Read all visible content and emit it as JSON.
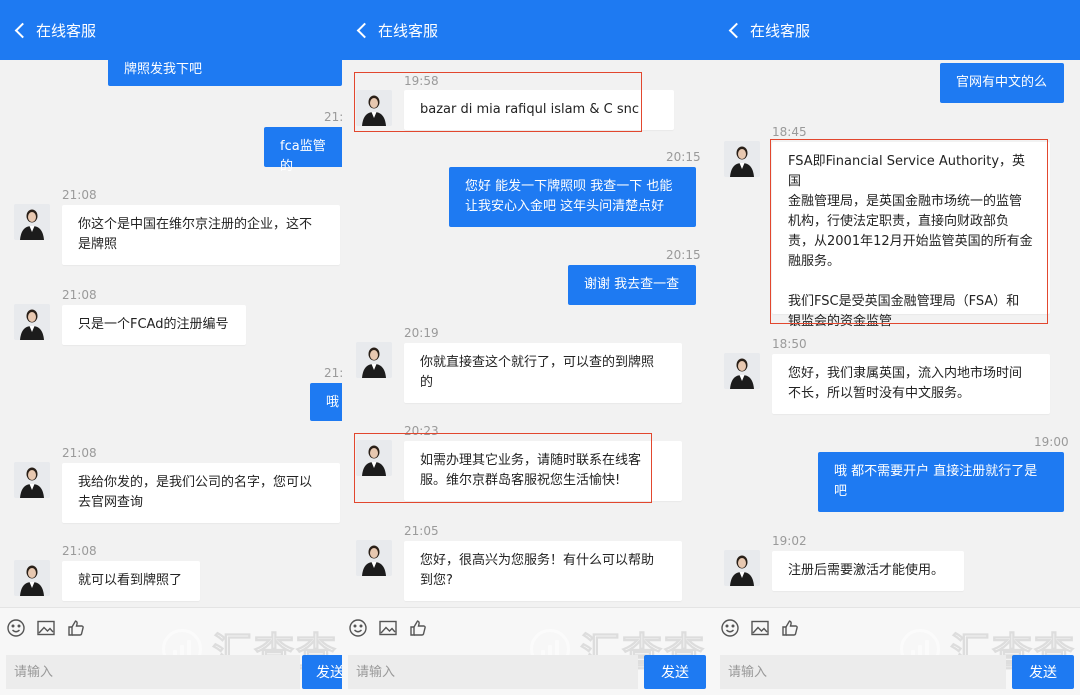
{
  "common": {
    "header_title": "在线客服",
    "input_placeholder": "请输入",
    "send_label": "发送",
    "watermark": "汇查查"
  },
  "panel1": {
    "messages": [
      {
        "dir": "out",
        "text": "牌照发我下吧"
      },
      {
        "dir": "out",
        "time": "21:",
        "text": "fca监管的"
      },
      {
        "dir": "in",
        "time": "21:08",
        "text": "你这个是中国在维尔京注册的企业，这不\n是牌照"
      },
      {
        "dir": "in",
        "time": "21:08",
        "text": "只是一个FCAd的注册编号"
      },
      {
        "dir": "out",
        "time": "21:",
        "text": "哦"
      },
      {
        "dir": "in",
        "time": "21:08",
        "text": "我给你发的，是我们公司的名字，您可以\n去官网查询"
      },
      {
        "dir": "in",
        "time": "21:08",
        "text": "就可以看到牌照了"
      }
    ]
  },
  "panel2": {
    "messages": [
      {
        "dir": "in",
        "time": "19:58",
        "text": "bazar di mia rafiqul islam & C snc"
      },
      {
        "dir": "out",
        "time": "20:15",
        "text": "您好 能发一下牌照呗 我查一下 也能\n让我安心入金吧 这年头问清楚点好"
      },
      {
        "dir": "out",
        "time": "20:15",
        "text": "谢谢 我去查一查"
      },
      {
        "dir": "in",
        "time": "20:19",
        "text": "你就直接查这个就行了，可以查的到牌照\n的"
      },
      {
        "dir": "in",
        "time": "20:23",
        "text": "如需办理其它业务，请随时联系在线客\n服。维尔京群岛客服祝您生活愉快!"
      },
      {
        "dir": "in",
        "time": "21:05",
        "text": "您好，很高兴为您服务！有什么可以帮助\n到您?"
      }
    ]
  },
  "panel3": {
    "messages": [
      {
        "dir": "out",
        "text": "官网有中文的么"
      },
      {
        "dir": "in",
        "time": "18:45",
        "text": "FSA即Financial Service Authority，英国\n金融管理局，是英国金融市场统一的监管\n机构，行使法定职责，直接向财政部负\n责，从2001年12月开始监管英国的所有金\n融服务。\n\n我们FSC是受英国金融管理局（FSA）和\n银监会的资金监管"
      },
      {
        "dir": "in",
        "time": "18:50",
        "text": "您好，我们隶属英国，流入内地市场时间\n不长，所以暂时没有中文服务。"
      },
      {
        "dir": "out",
        "time": "19:00",
        "text": "哦 都不需要开户 直接注册就行了是\n吧"
      },
      {
        "dir": "in",
        "time": "19:02",
        "text": "注册后需要激活才能使用。"
      }
    ]
  },
  "colors": {
    "header": "#1e7af2",
    "outgoing_bubble": "#1e7af2",
    "highlight_box": "#e2472e"
  },
  "icons": [
    "chevron-left-icon",
    "emoji-icon",
    "image-icon",
    "thumbs-up-icon",
    "agent-avatar-icon"
  ]
}
